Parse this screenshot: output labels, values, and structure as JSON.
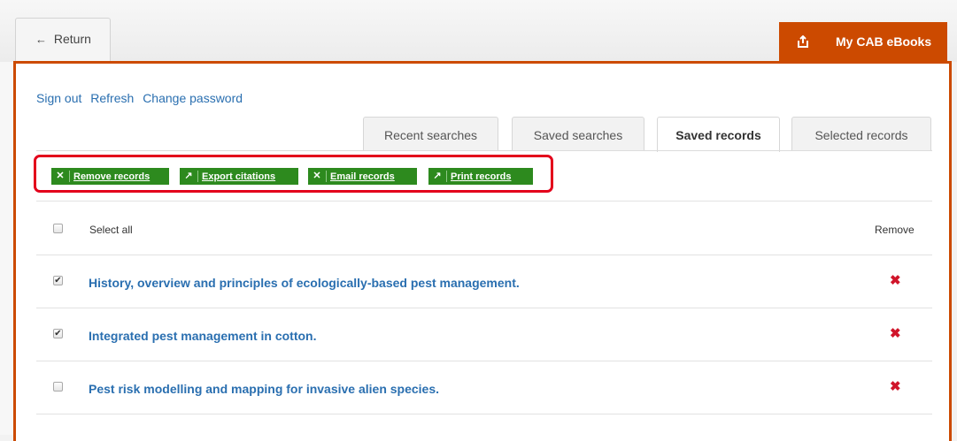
{
  "header": {
    "return_label": "Return",
    "return_icon": "left-arrow-icon",
    "brand_tab_label": "My CAB eBooks",
    "brand_tab_icon": "share-out-icon"
  },
  "user_links": [
    {
      "label": "Sign out"
    },
    {
      "label": "Refresh"
    },
    {
      "label": "Change password"
    }
  ],
  "tabs": [
    {
      "label": "Recent searches",
      "active": false
    },
    {
      "label": "Saved searches",
      "active": false
    },
    {
      "label": "Saved records",
      "active": true
    },
    {
      "label": "Selected records",
      "active": false
    }
  ],
  "actions": [
    {
      "icon": "close-icon",
      "label": "Remove records"
    },
    {
      "icon": "external-link-icon",
      "label": "Export citations"
    },
    {
      "icon": "close-icon",
      "label": "Email records"
    },
    {
      "icon": "external-link-icon",
      "label": "Print records"
    }
  ],
  "list": {
    "select_all_label": "Select all",
    "remove_header": "Remove",
    "records": [
      {
        "title": "History, overview and principles of ecologically-based pest management.",
        "checked": true
      },
      {
        "title": "Integrated pest management in cotton.",
        "checked": true
      },
      {
        "title": "Pest risk modelling and mapping for invasive alien species.",
        "checked": false
      }
    ]
  },
  "colors": {
    "brand": "#cc4a00",
    "action_green": "#2d8a1e",
    "link_blue": "#2a6fb0",
    "remove_red": "#d0152a",
    "highlight": "#e3001b"
  }
}
